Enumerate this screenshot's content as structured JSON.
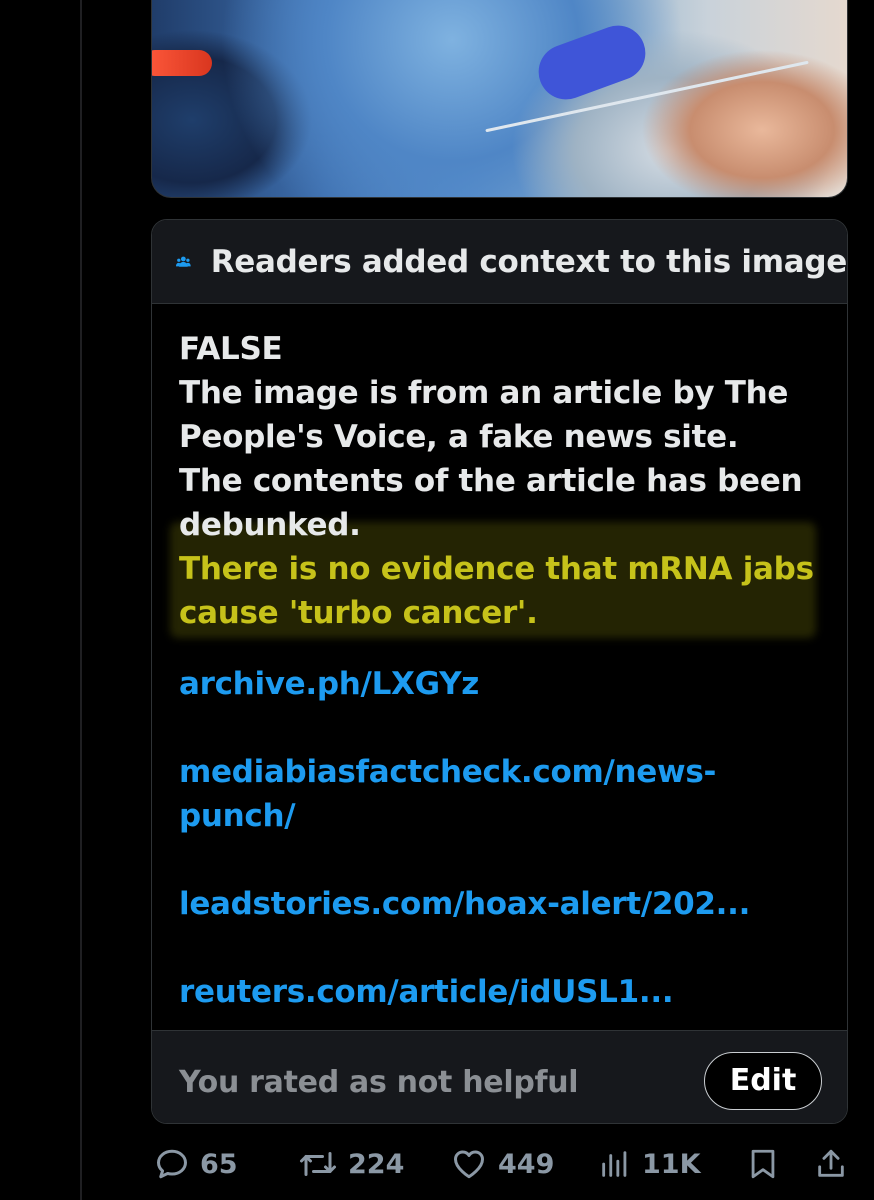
{
  "context_card": {
    "header": "Readers added context to this image",
    "note_lines": [
      "FALSE",
      "The image is from an article by The People's Voice, a fake news site.",
      "The contents of the article has been debunked."
    ],
    "highlighted_line": "There is no evidence that mRNA jabs cause 'turbo cancer'.",
    "links": [
      "archive.ph/LXGYz",
      "mediabiasfactcheck.com/news-punch/",
      "leadstories.com/hoax-alert/202...",
      "reuters.com/article/idUSL1..."
    ],
    "rating_text": "You rated as not helpful",
    "edit_label": "Edit"
  },
  "actions": {
    "replies": "65",
    "reposts": "224",
    "likes": "449",
    "views": "11K"
  },
  "colors": {
    "background": "#000000",
    "card_header": "#16181c",
    "link": "#1d9bf0",
    "highlight_text": "#c6c21a",
    "muted": "#8b98a5"
  },
  "icons": [
    "people-icon",
    "reply-icon",
    "repost-icon",
    "like-icon",
    "views-icon",
    "bookmark-icon",
    "share-icon"
  ]
}
